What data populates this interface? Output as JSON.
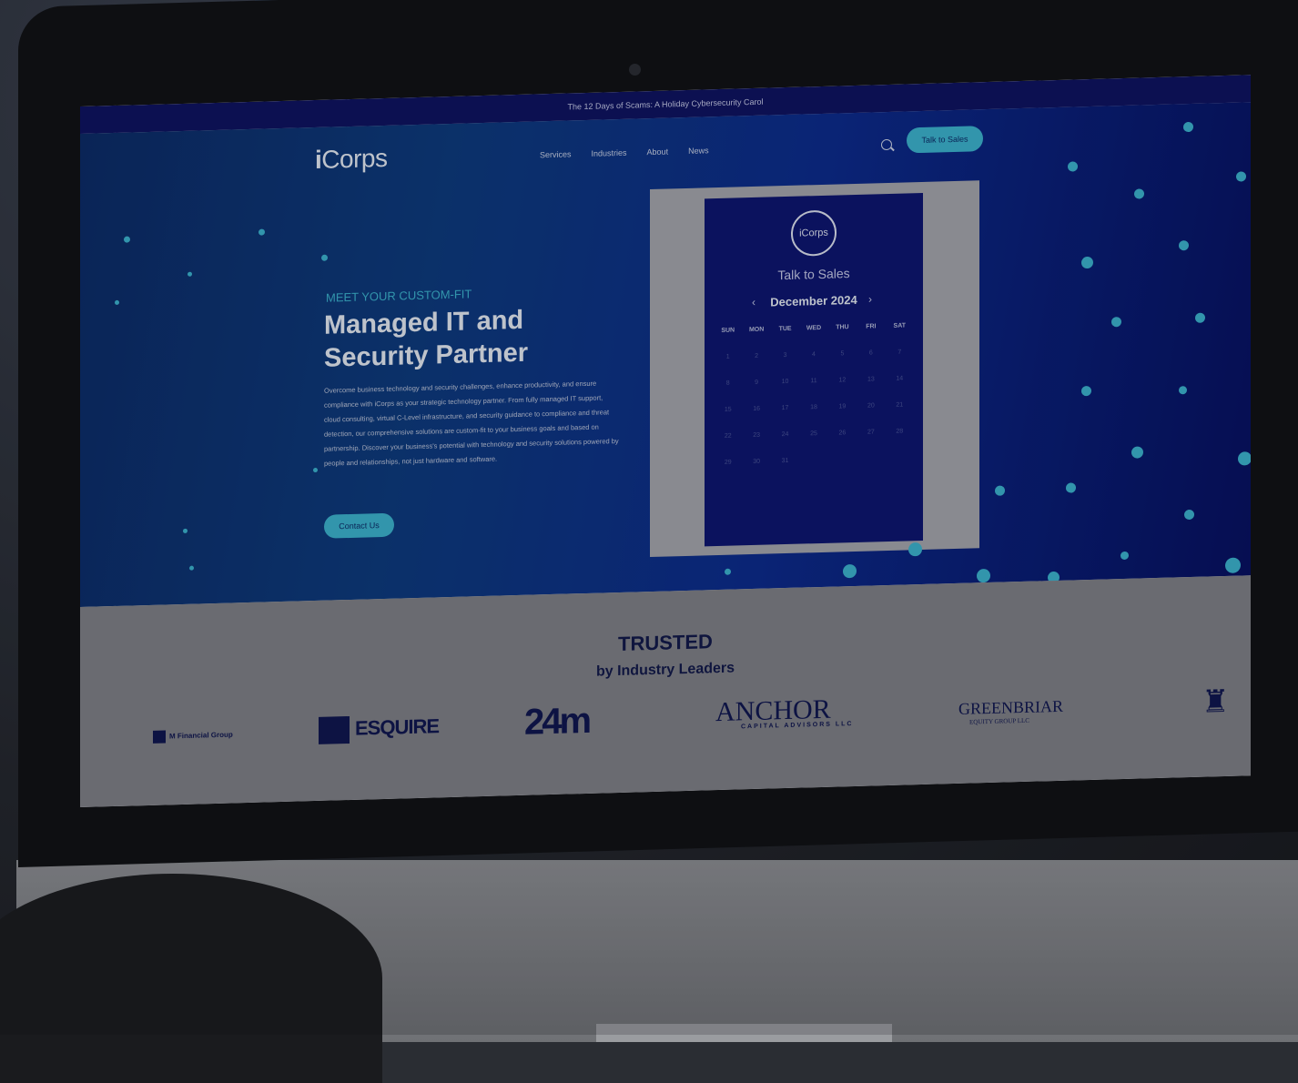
{
  "announcement": "The 12 Days of Scams: A Holiday Cybersecurity Carol",
  "nav": {
    "logo_mark": "i",
    "logo_text": "Corps",
    "items": [
      "Services",
      "Industries",
      "About",
      "News"
    ],
    "search_icon": "search-icon",
    "cta": "Talk to Sales"
  },
  "hero": {
    "kicker": "MEET YOUR CUSTOM-FIT",
    "headline_line1": "Managed IT and",
    "headline_line2": "Security Partner",
    "body": "Overcome business technology and security challenges, enhance productivity, and ensure compliance with iCorps as your strategic technology partner. From fully managed IT support, cloud consulting, virtual C-Level infrastructure, and security guidance to compliance and threat detection, our comprehensive solutions are custom-fit to your business goals and based on partnership. Discover your business's potential with technology and security solutions powered by people and relationships, not just hardware and software.",
    "contact_button": "Contact Us"
  },
  "calendar": {
    "logo": "iCorps",
    "title": "Talk to Sales",
    "month": "December 2024",
    "prev": "‹",
    "next": "›",
    "days_of_week": [
      "SUN",
      "MON",
      "TUE",
      "WED",
      "THU",
      "FRI",
      "SAT"
    ],
    "dates": [
      "1",
      "2",
      "3",
      "4",
      "5",
      "6",
      "7",
      "8",
      "9",
      "10",
      "11",
      "12",
      "13",
      "14",
      "15",
      "16",
      "17",
      "18",
      "19",
      "20",
      "21",
      "22",
      "23",
      "24",
      "25",
      "26",
      "27",
      "28",
      "29",
      "30",
      "31"
    ]
  },
  "trusted": {
    "title": "TRUSTED",
    "subtitle": "by Industry Leaders",
    "logos": {
      "logo1": "M Financial Group",
      "logo2": "ESQUIRE",
      "logo3": "24m",
      "logo4": "ANCHOR",
      "logo4_sub": "CAPITAL ADVISORS LLC",
      "logo5": "GREENBRIAR",
      "logo5_sub": "EQUITY GROUP LLC",
      "logo6": "♜"
    }
  },
  "colors": {
    "accent": "#3bb4cf",
    "hero_dark": "#0a2a66",
    "calendar_bg": "#0b1470",
    "announce_bg": "#0d1260"
  }
}
